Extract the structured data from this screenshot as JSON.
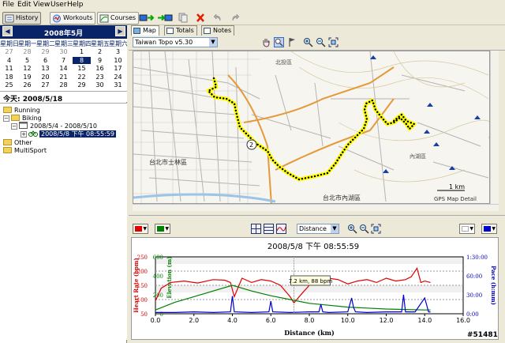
{
  "menu": [
    "File",
    "Edit",
    "View",
    "User",
    "Help"
  ],
  "toolbar": {
    "history": "History",
    "workouts": "Workouts",
    "courses": "Courses"
  },
  "calendar": {
    "month_title": "2008年5月",
    "weekdays": [
      "星期日",
      "星期一",
      "星期二",
      "星期三",
      "星期四",
      "星期五",
      "星期六"
    ],
    "rows": [
      [
        "27",
        "28",
        "29",
        "30",
        "1",
        "2",
        "3"
      ],
      [
        "4",
        "5",
        "6",
        "7",
        "8",
        "9",
        "10"
      ],
      [
        "11",
        "12",
        "13",
        "14",
        "15",
        "16",
        "17"
      ],
      [
        "18",
        "19",
        "20",
        "21",
        "22",
        "23",
        "24"
      ],
      [
        "25",
        "26",
        "27",
        "28",
        "29",
        "30",
        "31"
      ]
    ],
    "selected": "8",
    "today_label": "今天: 2008/5/18"
  },
  "tree": {
    "running": "Running",
    "biking": "Biking",
    "week": "2008/5/4 - 2008/5/10",
    "activity": "2008/5/8 下午 08:55:59",
    "other": "Other",
    "multisport": "MultiSport"
  },
  "tabs": {
    "map": "Map",
    "totals": "Totals",
    "notes": "Notes"
  },
  "map": {
    "source": "Taiwan Topo v5.30",
    "scale": "1 km",
    "status": "GPS Map Detail",
    "labels": [
      "台北市士林區",
      "北投區",
      "台北市內湖區",
      "內湖區"
    ]
  },
  "chart_controls": {
    "xaxis": "Distance",
    "hr_color": "#e00000",
    "elev_color": "#008000",
    "pace_color": "#0000d0"
  },
  "chart_data": {
    "type": "line",
    "title": "2008/5/8 下午 08:55:59",
    "xlabel": "Distance (km)",
    "ylabel_left1": "Heart Rate (bpm)",
    "ylabel_left2": "Elevation (m)",
    "ylabel_right": "Pace (h:mm)",
    "x_ticks": [
      "0.0",
      "2.0",
      "4.0",
      "6.0",
      "8.0",
      "10.0",
      "12.0",
      "14.0",
      "16.0"
    ],
    "hr_ticks": [
      "50",
      "100",
      "150",
      "200",
      "250"
    ],
    "elev_ticks": [
      "0",
      "200",
      "400",
      "600"
    ],
    "pace_ticks": [
      "0:00",
      "30:00",
      "60:00",
      "1:30:00"
    ],
    "xlim": [
      0,
      16
    ],
    "tooltip": "7.2 km, 88 bpm",
    "series": [
      {
        "name": "Heart Rate",
        "x": [
          0,
          0.3,
          0.8,
          1.5,
          2.2,
          3.0,
          3.6,
          3.9,
          4.1,
          4.5,
          5.0,
          5.5,
          6.0,
          6.5,
          7.0,
          7.2,
          7.6,
          8.0,
          8.5,
          9.0,
          9.5,
          10.0,
          10.5,
          11.0,
          11.5,
          12.0,
          12.5,
          13.0,
          13.3,
          13.6,
          13.8,
          14.0,
          14.3
        ],
        "values": [
          95,
          140,
          160,
          165,
          158,
          170,
          168,
          160,
          110,
          175,
          160,
          170,
          165,
          150,
          110,
          88,
          120,
          150,
          165,
          175,
          170,
          155,
          165,
          170,
          160,
          175,
          165,
          170,
          180,
          210,
          160,
          165,
          160
        ]
      },
      {
        "name": "Elevation",
        "x": [
          0,
          1,
          2,
          3,
          4,
          5,
          6,
          7,
          8,
          9,
          10,
          11,
          12,
          13,
          14,
          14.3
        ],
        "values": [
          40,
          120,
          180,
          240,
          300,
          240,
          190,
          150,
          110,
          90,
          70,
          60,
          50,
          45,
          40,
          40
        ]
      },
      {
        "name": "Pace",
        "x": [
          0,
          1,
          2,
          3,
          3.9,
          4.0,
          4.1,
          5,
          5.9,
          6.0,
          6.1,
          7,
          8,
          8.5,
          8.6,
          8.7,
          9,
          10,
          10.2,
          10.3,
          10.4,
          11,
          12,
          12.8,
          12.9,
          13.0,
          13.5,
          14,
          14.2,
          14.3
        ],
        "values": [
          2,
          2,
          3,
          2,
          3,
          28,
          3,
          2,
          3,
          20,
          3,
          2,
          3,
          3,
          15,
          3,
          2,
          3,
          25,
          10,
          3,
          2,
          3,
          3,
          30,
          3,
          3,
          25,
          3,
          3
        ]
      }
    ]
  },
  "watermark": "#51481"
}
